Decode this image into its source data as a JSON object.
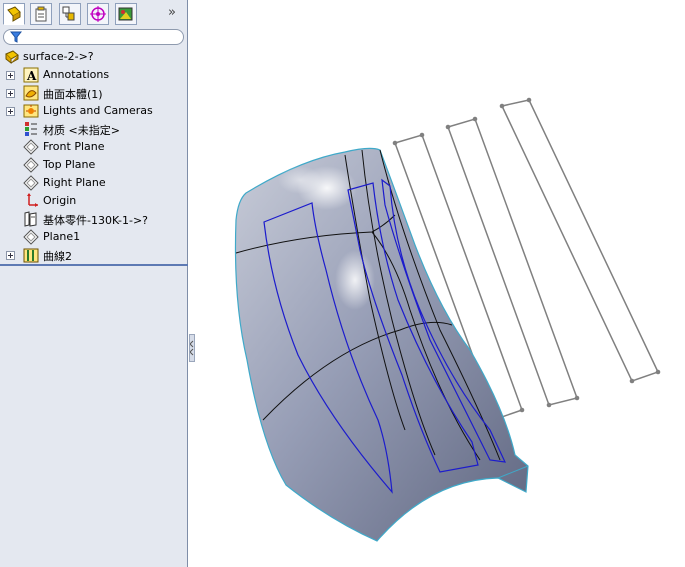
{
  "tabs": [
    {
      "name": "feature-manager"
    },
    {
      "name": "property-manager"
    },
    {
      "name": "configuration-manager"
    },
    {
      "name": "dimxpert-manager"
    },
    {
      "name": "display-manager"
    }
  ],
  "more_symbol": "»",
  "tree": [
    {
      "label": "surface-2->?",
      "icon": "part-icon",
      "expander": false
    },
    {
      "label": "Annotations",
      "icon": "annotations-icon",
      "expander": true
    },
    {
      "label": "曲面本體(1)",
      "icon": "surface-bodies-icon",
      "expander": true
    },
    {
      "label": "Lights and Cameras",
      "icon": "lights-icon",
      "expander": true
    },
    {
      "label": "材质 <未指定>",
      "icon": "material-icon",
      "expander": false
    },
    {
      "label": "Front Plane",
      "icon": "plane-icon",
      "expander": false
    },
    {
      "label": "Top Plane",
      "icon": "plane-icon",
      "expander": false
    },
    {
      "label": "Right Plane",
      "icon": "plane-icon",
      "expander": false
    },
    {
      "label": "Origin",
      "icon": "origin-icon",
      "expander": false
    },
    {
      "label": "基体零件-130K-1->?",
      "icon": "base-part-icon",
      "expander": false
    },
    {
      "label": "Plane1",
      "icon": "plane-icon",
      "expander": false
    },
    {
      "label": "曲線2",
      "icon": "curve-icon",
      "expander": true
    }
  ],
  "colors": {
    "panel_bg": "#e4e8f0",
    "separator": "#5d79b3",
    "surface": "#8d96b0",
    "edge_blue": "#1c1ccc",
    "sketch_gray": "#808080"
  }
}
